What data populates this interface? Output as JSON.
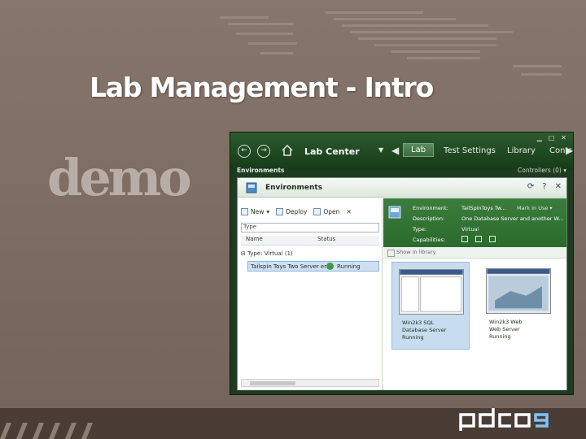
{
  "slide": {
    "title": "Lab Management - Intro",
    "demo_label": "demo",
    "logo_text": "pdc09"
  },
  "window": {
    "app_title": "Lab Center",
    "tabs": [
      "Lab",
      "Test Settings",
      "Library",
      "Contr"
    ],
    "active_tab": "Lab",
    "breadcrumb": "Environments",
    "controllers_link": "Controllers (0) ▾"
  },
  "environments": {
    "panel_title": "Environments",
    "toolbar": {
      "new": "New",
      "deploy": "Deploy",
      "open": "Open"
    },
    "filter_placeholder": "Type",
    "columns": {
      "name": "Name",
      "status": "Status"
    },
    "group": "Type: Virtual (1)",
    "rows": [
      {
        "name": "Tailspin Toys Two Server env",
        "status": "Running"
      }
    ]
  },
  "details": {
    "environment_label": "Environment:",
    "environment_value": "TailSpinToys Tw...",
    "work_in_use": "Mark In Use ▾",
    "description_label": "Description:",
    "description_value": "One Database Server and another W...",
    "type_label": "Type:",
    "type_value": "Virtual",
    "capabilities_label": "Capabilities:",
    "show_in_library": "Show in library"
  },
  "vms": [
    {
      "line1": "Win2k3 SQL",
      "line2": "Database Server",
      "line3": "Running"
    },
    {
      "line1": "Win2k3 Web",
      "line2": "Web Server",
      "line3": "Running"
    }
  ],
  "colors": {
    "slide_bg": "#7a6a60",
    "window_chrome": "#1f3a20",
    "detail_green": "#3c7c3d",
    "selected_blue": "#cfe0f4"
  }
}
